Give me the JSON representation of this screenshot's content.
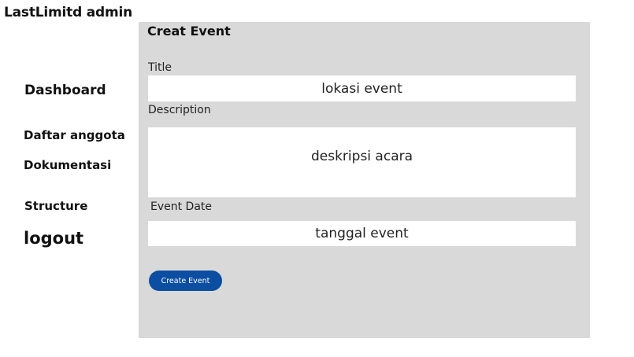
{
  "app": {
    "title": "LastLimitd admin"
  },
  "sidebar": {
    "items": [
      {
        "label": "Dashboard"
      },
      {
        "label": "Daftar anggota"
      },
      {
        "label": "Dokumentasi"
      },
      {
        "label": "Structure"
      },
      {
        "label": "logout"
      }
    ]
  },
  "form": {
    "heading": "Creat Event",
    "title_label": "Title",
    "title_placeholder": "lokasi event",
    "description_label": "Description",
    "description_placeholder": "deskripsi acara",
    "date_label": "Event Date",
    "date_placeholder": "tanggal event",
    "submit_label": "Create Event"
  },
  "colors": {
    "panel_bg": "#d9d9d9",
    "button_bg": "#0b4ea2",
    "field_bg": "#ffffff"
  }
}
